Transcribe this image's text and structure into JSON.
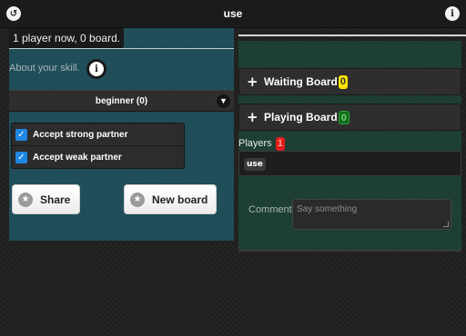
{
  "header": {
    "title": "use",
    "back_icon": "back-arrow-icon",
    "info_icon": "info-icon"
  },
  "left": {
    "status": "1 player now, 0 board.",
    "about_label": "About your skill.",
    "skill_select": "beginner (0)",
    "checkboxes": [
      {
        "label": "Accept strong partner",
        "checked": true
      },
      {
        "label": "Accept weak partner",
        "checked": true
      }
    ],
    "share_label": "Share",
    "new_board_label": "New board"
  },
  "right": {
    "waiting": {
      "label": "Waiting Board",
      "count": "0"
    },
    "playing": {
      "label": "Playing Board",
      "count": "0"
    },
    "players": {
      "label": "Players",
      "count": "1",
      "list": [
        "use"
      ]
    },
    "comment": {
      "label": "Comment",
      "placeholder": "Say something"
    }
  },
  "colors": {
    "left_panel": "#1e4a55",
    "right_panel": "#1b3a2e",
    "checkbox": "#1e88e5",
    "badge_yellow": "#ffe600",
    "badge_green": "#0f6b1b",
    "badge_red": "#e21b1b"
  }
}
